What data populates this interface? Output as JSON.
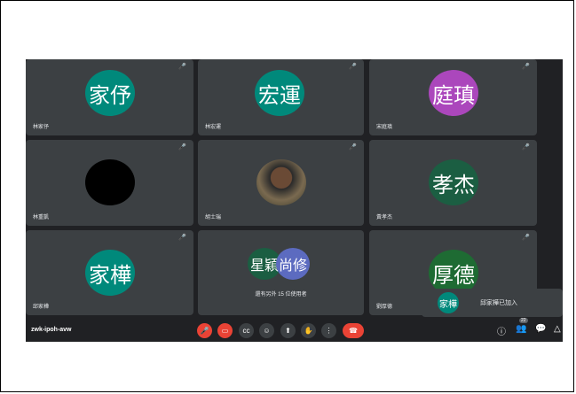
{
  "meeting": {
    "code": "zwk-ipoh-avw"
  },
  "tiles": [
    {
      "initials": "家伃",
      "color": "#00897b",
      "name": "林家伃"
    },
    {
      "initials": "宏運",
      "color": "#00897b",
      "name": "林宏運"
    },
    {
      "initials": "庭瑱",
      "color": "#ab47bc",
      "name": "宋庭瑱"
    },
    {
      "initials": "",
      "color": "#000000",
      "name": "林重凱"
    },
    {
      "initials": "",
      "color": "#000000",
      "name": "胡士瑞"
    },
    {
      "initials": "孝杰",
      "color": "#1b5e42",
      "name": "黃孝杰"
    },
    {
      "initials": "家樺",
      "color": "#00897b",
      "name": "邱家樺"
    },
    {
      "initials": "厚德",
      "color": "#1e6b33",
      "name": "劉厚德"
    }
  ],
  "group_tile": {
    "avatar_1": "星穎",
    "avatar_1_color": "#1b5e42",
    "avatar_2": "尚修",
    "avatar_2_color": "#5c6bc0",
    "text": "還有另外 15 位使用者"
  },
  "notice": {
    "avatar": "家樺",
    "text": "邱家樺已加入"
  },
  "participant_count": "22",
  "icons": {
    "mic": "mic-off-icon",
    "camera": "camera-off-icon",
    "captions": "captions-icon",
    "emoji": "emoji-icon",
    "present": "present-screen-icon",
    "hand": "raise-hand-icon",
    "more": "more-options-icon",
    "end": "end-call-icon",
    "info": "info-icon",
    "people": "people-icon",
    "chat": "chat-icon",
    "activities": "activities-icon"
  }
}
